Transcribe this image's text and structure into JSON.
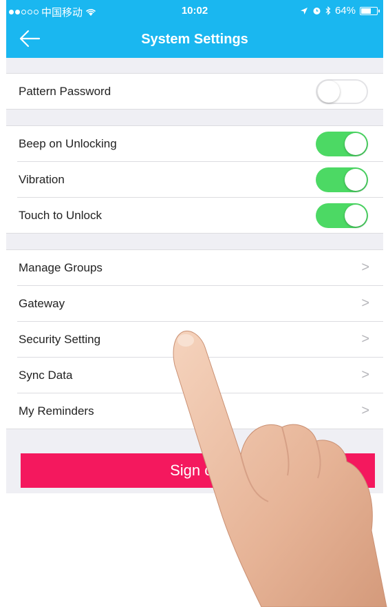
{
  "status_bar": {
    "carrier": "中国移动",
    "time": "10:02",
    "battery": "64%",
    "battery_level": 0.64
  },
  "nav": {
    "title": "System Settings",
    "back_icon": "back-arrow-icon"
  },
  "security_group": [
    {
      "label": "Pattern Password",
      "toggle": false
    }
  ],
  "toggle_group": [
    {
      "label": "Beep on Unlocking",
      "toggle": true
    },
    {
      "label": "Vibration",
      "toggle": true
    },
    {
      "label": "Touch to Unlock",
      "toggle": true
    }
  ],
  "menu_group": [
    {
      "label": "Manage Groups"
    },
    {
      "label": "Gateway"
    },
    {
      "label": "Security Setting"
    },
    {
      "label": "Sync Data"
    },
    {
      "label": "My Reminders"
    }
  ],
  "sign_out_label": "Sign out",
  "colors": {
    "nav_bar": "#1ab7f0",
    "toggle_on": "#4cd964",
    "sign_out": "#f4185e"
  }
}
